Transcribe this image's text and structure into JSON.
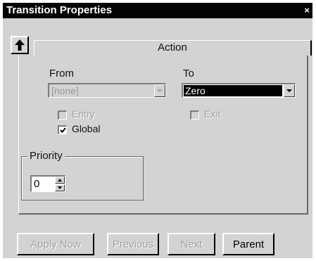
{
  "window": {
    "title": "Transition Properties",
    "close_glyph": "×"
  },
  "toolbar": {
    "up_icon": "up-arrow-icon"
  },
  "tabs": [
    {
      "label": "Action"
    }
  ],
  "from": {
    "label": "From",
    "value": "[none]",
    "enabled": false
  },
  "to": {
    "label": "To",
    "value": "Zero",
    "enabled": true
  },
  "checkboxes": {
    "entry": {
      "label": "Entry",
      "checked": false,
      "enabled": false
    },
    "global": {
      "label": "Global",
      "checked": true,
      "enabled": true
    },
    "exit": {
      "label": "Exit",
      "checked": false,
      "enabled": false
    }
  },
  "priority": {
    "label": "Priority",
    "value": "0"
  },
  "buttons": {
    "apply_now": {
      "label": "Apply Now",
      "enabled": false
    },
    "previous": {
      "label": "Previous",
      "enabled": false
    },
    "next": {
      "label": "Next",
      "enabled": false
    },
    "parent": {
      "label": "Parent",
      "enabled": true
    }
  }
}
